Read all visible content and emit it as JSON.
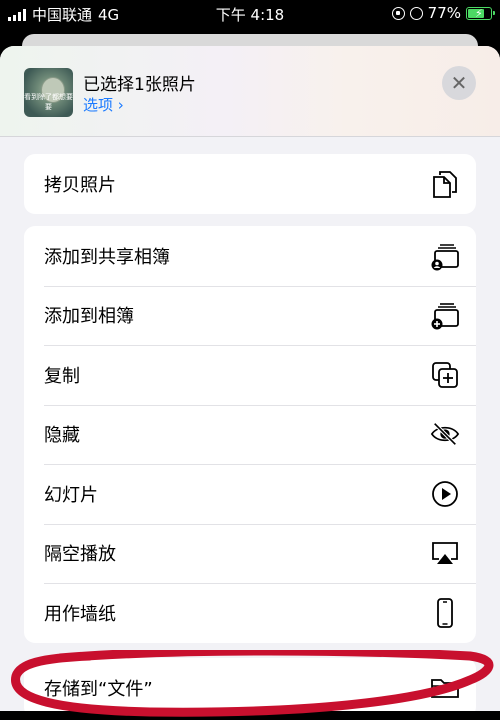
{
  "status_bar": {
    "carrier": "中国联通",
    "network": "4G",
    "time": "下午 4:18",
    "battery_percent": "77%",
    "battery_level": 0.77
  },
  "header": {
    "title": "已选择1张照片",
    "options_label": "选项 ›",
    "thumbnail_caption": "看到除了都想要要",
    "close_symbol": "✕"
  },
  "groups": [
    {
      "items": [
        {
          "label": "拷贝照片",
          "icon": "copy-doc-icon"
        }
      ]
    },
    {
      "items": [
        {
          "label": "添加到共享相簿",
          "icon": "shared-album-icon"
        },
        {
          "label": "添加到相簿",
          "icon": "add-album-icon"
        },
        {
          "label": "复制",
          "icon": "duplicate-icon"
        },
        {
          "label": "隐藏",
          "icon": "eye-slash-icon"
        },
        {
          "label": "幻灯片",
          "icon": "play-circle-icon"
        },
        {
          "label": "隔空播放",
          "icon": "airplay-icon"
        },
        {
          "label": "用作墙纸",
          "icon": "phone-icon"
        }
      ]
    },
    {
      "items": [
        {
          "label": "存储到“文件”",
          "icon": "folder-icon"
        }
      ]
    }
  ],
  "colors": {
    "accent": "#1a7aff",
    "annotation": "#c8102e"
  }
}
